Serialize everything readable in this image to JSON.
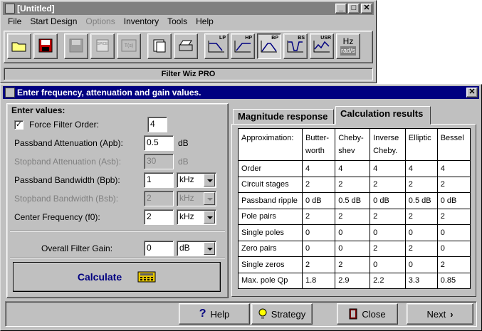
{
  "main_window": {
    "title": "[Untitled]",
    "menu": [
      "File",
      "Start Design",
      "Options",
      "Inventory",
      "Tools",
      "Help"
    ],
    "menu_dim": [
      "Options"
    ],
    "toolbar": [
      {
        "name": "open-icon",
        "label": ""
      },
      {
        "name": "save-icon",
        "label": ""
      },
      {
        "name": "save-all-icon",
        "label": ""
      },
      {
        "name": "spice-icon",
        "label": "SPICE"
      },
      {
        "name": "transfer-function-icon",
        "label": "T(s)"
      },
      {
        "name": "copy-clipboard-icon",
        "label": ""
      },
      {
        "name": "print-icon",
        "label": ""
      },
      {
        "name": "lowpass-icon",
        "label": "LP"
      },
      {
        "name": "highpass-icon",
        "label": "HP"
      },
      {
        "name": "bandpass-icon",
        "label": "BP"
      },
      {
        "name": "bandstop-icon",
        "label": "BS"
      },
      {
        "name": "user-filter-icon",
        "label": "USR"
      },
      {
        "name": "hz-rads-icon",
        "label": "Hz"
      }
    ],
    "hz_sub": "rad/s",
    "status": "Filter Wiz PRO"
  },
  "dialog": {
    "title": "Enter frequency, attenuation and gain values.",
    "values_heading": "Enter values:",
    "force_order": {
      "label": "Force Filter Order:",
      "checked": "✓",
      "value": "4"
    },
    "passband_atten": {
      "label": "Passband Attenuation  (Apb):",
      "value": "0.5",
      "unit": "dB"
    },
    "stopband_atten": {
      "label": "Stopband Attenuation (Asb):",
      "value": "30",
      "unit": "dB"
    },
    "passband_bw": {
      "label": "Passband Bandwidth (Bpb):",
      "value": "1",
      "unit": "kHz"
    },
    "stopband_bw": {
      "label": "Stopband Bandwidth (Bsb):",
      "value": "2",
      "unit": "kHz"
    },
    "center_freq": {
      "label": "Center Frequency (f0):",
      "value": "2",
      "unit": "kHz"
    },
    "gain": {
      "label": "Overall Filter Gain:",
      "value": "0",
      "unit": "dB"
    },
    "calculate_label": "Calculate",
    "tabs": [
      "Magnitude response",
      "Calculation results"
    ],
    "table": {
      "header": [
        "Approximation:",
        "Butter-\nworth",
        "Cheby-\nshev",
        "Inverse\nCheby.",
        "Elliptic",
        "Bessel"
      ],
      "rows": [
        [
          "Order",
          "4",
          "4",
          "4",
          "4",
          "4"
        ],
        [
          "Circuit stages",
          "2",
          "2",
          "2",
          "2",
          "2"
        ],
        [
          "Passband ripple",
          "0 dB",
          "0.5 dB",
          "0 dB",
          "0.5 dB",
          "0 dB"
        ],
        [
          "Pole pairs",
          "2",
          "2",
          "2",
          "2",
          "2"
        ],
        [
          "Single poles",
          "0",
          "0",
          "0",
          "0",
          "0"
        ],
        [
          "Zero pairs",
          "0",
          "0",
          "2",
          "2",
          "0"
        ],
        [
          "Single zeros",
          "2",
          "2",
          "0",
          "0",
          "2"
        ],
        [
          "Max. pole Qp",
          "1.8",
          "2.9",
          "2.2",
          "3.3",
          "0.85"
        ]
      ]
    },
    "buttons": {
      "help": "Help",
      "strategy": "Strategy",
      "close": "Close",
      "next": "Next"
    }
  },
  "colors": {
    "title_active": "#000080",
    "title_inactive": "#808080",
    "calc_text": "#000080"
  }
}
